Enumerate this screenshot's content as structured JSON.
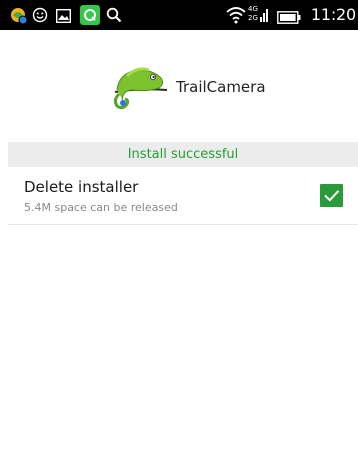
{
  "status_bar": {
    "time": "11:20",
    "network_label": "4G",
    "icons": [
      "app-notification-icon",
      "smile-icon",
      "image-icon",
      "green-app-icon",
      "search-icon",
      "wifi-icon",
      "signal-icon",
      "battery-icon"
    ]
  },
  "app": {
    "name": "TrailCamera",
    "icon": "chameleon-logo-icon"
  },
  "banner": {
    "text": "Install successful"
  },
  "option": {
    "title": "Delete installer",
    "subtitle": "5.4M space can be released",
    "checked": true
  },
  "colors": {
    "status_bar": "#000000",
    "banner_bg": "#ececec",
    "success_green": "#21a131",
    "checkbox_green": "#2a9b3a"
  }
}
